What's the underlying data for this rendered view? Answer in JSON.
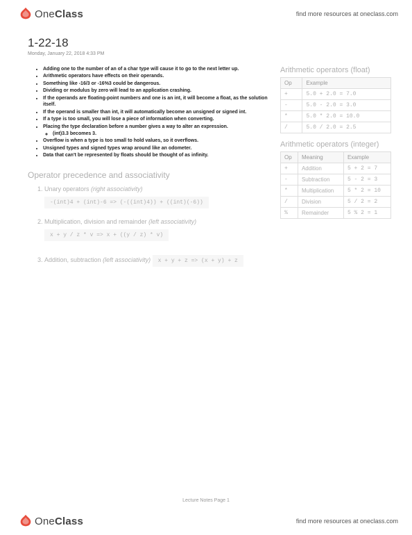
{
  "brand": {
    "text1": "One",
    "text2": "Class"
  },
  "promo": "find more resources at oneclass.com",
  "title": "1-22-18",
  "meta": "Monday, January 22, 2018    4:33 PM",
  "bullets": [
    "Adding one to the number of an of a char type will cause it to go to the next letter up.",
    "Arithmetic operators have effects on their operands.",
    "Something like -16/3 or -16%3 could be dangerous.",
    "Dividing or modulus by zero will lead to an application crashing.",
    "If the operands are floating-point numbers and one is an int, it will become a float, as the solution itself.",
    "If the operand is smaller than int, it will automatically become an unsigned or signed int.",
    "If a type is too small, you will lose a piece of information when converting.",
    "Placing the type declaration before a number gives a way to alter an expression."
  ],
  "sub1": "(int)3.3 becomes 3.",
  "bullets2": [
    "Overflow is when a type is too small to hold values, so it overflows.",
    "Unsigned types and signed types wrap around like an odometer.",
    "Data that can't be represented by floats should be thought of as infinity."
  ],
  "section": "Operator precedence and associativity",
  "items": [
    {
      "label": "Unary operators",
      "assoc": "(right associativity)",
      "code": "-(int)4 + (int)-6 => (-((int)4)) + ((int)(-6))"
    },
    {
      "label": "Multiplication, division and remainder",
      "assoc": "(left associativity)",
      "code": "x + y / z * v => x + ((y / z) * v)"
    },
    {
      "label": "Addition, subtraction",
      "assoc": "(left associativity)",
      "code": "x + y + z => (x + y) + z"
    }
  ],
  "floatTitle": "Arithmetic operators (float)",
  "floatTable": {
    "headers": [
      "Op",
      "Example"
    ],
    "rows": [
      [
        "+",
        "5.0 + 2.0 = 7.0"
      ],
      [
        "-",
        "5.0 - 2.0 = 3.0"
      ],
      [
        "*",
        "5.0 * 2.0 = 10.0"
      ],
      [
        "/",
        "5.0 / 2.0 = 2.5"
      ]
    ]
  },
  "intTitle": "Arithmetic operators (integer)",
  "intTable": {
    "headers": [
      "Op",
      "Meaning",
      "Example"
    ],
    "rows": [
      [
        "+",
        "Addition",
        "5 + 2 = 7"
      ],
      [
        "-",
        "Subtraction",
        "5 - 2 = 3"
      ],
      [
        "*",
        "Multiplication",
        "5 * 2 = 10"
      ],
      [
        "/",
        "Division",
        "5 / 2 = 2"
      ],
      [
        "%",
        "Remainder",
        "5 % 2 = 1"
      ]
    ]
  },
  "pagenum": "Lecture Notes Page 1"
}
